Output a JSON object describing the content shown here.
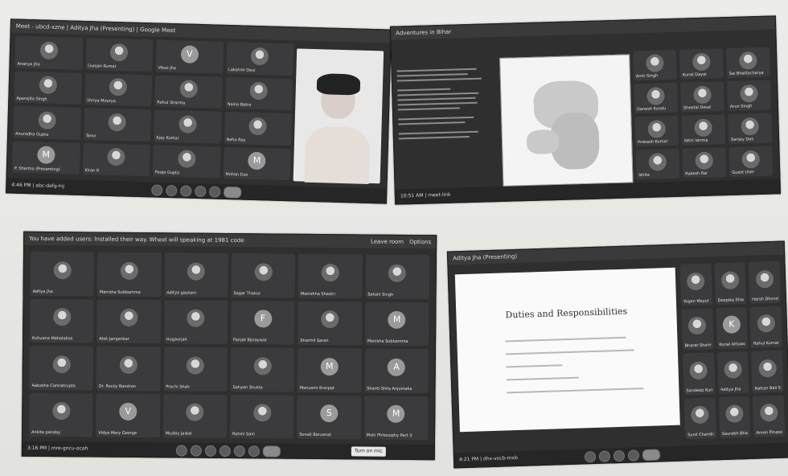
{
  "screens": {
    "bottom_left": {
      "header": "You have added users: Installed their way. Wheel will speaking at 1981 code",
      "header_right": [
        "Leave room",
        "Options"
      ],
      "tiles": [
        "Aditya Jha",
        "Manisha Subbamma",
        "Aditya gautam",
        "Sagar Thakur",
        "Manishha Shastri",
        "Sakshi Singh",
        "Kuhuana Mahalabas",
        "Alok Jangankar",
        "Hugaurjah",
        "Parijat Bijnaywar",
        "Sharmil Saran",
        "Manisha Subbamma",
        "Aakasha Cannatrupta",
        "Dr. Rocky Bandran",
        "Prachi Shah",
        "Sahyan Shukla",
        "Manusmi Brarpat",
        "Shanti Shila Anjumaka",
        "Ankita panday",
        "Vidya Mary George",
        "Muzbiy Jaibal",
        "Rohini Sain",
        "Sonali Baruanal",
        "Muki Philosophy Part 3"
      ],
      "tile_letters": {
        "9": "F",
        "11": "M",
        "16": "M",
        "17": "A",
        "19": "V",
        "22": "S",
        "23": "M"
      },
      "clock": "3:16 PM | mre-gncu-ocah",
      "leave_btn": "Turn on mic"
    },
    "bottom_right": {
      "header": "Aditya Jha (Presenting)",
      "doc_title": "Duties and Responsibilities",
      "tiles": [
        "Yogen Mayur",
        "Deepika Sharma",
        "Harsh Dhondhuwarn",
        "Bharat Sharma",
        "Kunal Ahluwalia",
        "Rahul Kumar",
        "Sandeep Kumar",
        "Aditya Jha",
        "Rattan Bali Singh",
        "Sunil Chandra",
        "Saurabh Bhat",
        "Aman Pirupama"
      ],
      "tile_letters": {
        "4": "K"
      },
      "clock": "4:21 PM | dhx-vocb-mxb"
    },
    "top_left": {
      "header": "Meet - ubcd-xzne | Aditya Jha (Presenting) | Google Meet",
      "tiles": [
        "Ananya Jha",
        "Gunjan Kumar",
        "Vikas Jha",
        "Lakshmi Devi",
        "Aparajita Singh",
        "Shriya Mourya",
        "Rahul Sharma",
        "Naina Batra",
        "Anuradha Gupta",
        "Tanvi",
        "Ajay Kumar",
        "Neha Roy",
        "P. Sharma (Presenting)",
        "Kiran R",
        "Pooja Gupta",
        "Mohan Das"
      ],
      "tile_letters": {
        "2": "V",
        "12": "M",
        "15": "M"
      },
      "clock": "4:46 PM | abc-defg-hij"
    },
    "top_right": {
      "header": "Adventures in Bihar",
      "tiles": [
        "Amit Singh",
        "Kunal Dayal",
        "Sai Bhattacharya",
        "Ganesh Kundu",
        "Sheetal Desai",
        "Arun Singh",
        "Prakash Kumar",
        "Nitin Verma",
        "Sanjay Das",
        "Ishita",
        "Rakesh Rai",
        "Guest User"
      ],
      "clock": "10:51 AM | meet-link"
    }
  }
}
